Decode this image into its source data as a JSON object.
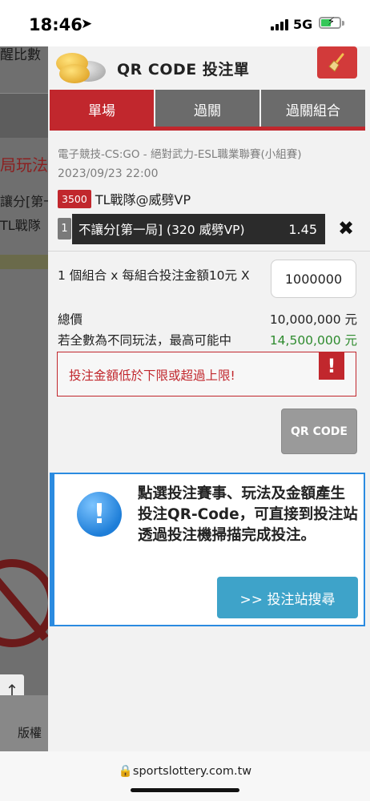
{
  "status_bar": {
    "time": "18:46",
    "network": "5G"
  },
  "background_page": {
    "texts": [
      "醒比數",
      "局玩法",
      "讓分[第一",
      "TL戰隊",
      "版權"
    ]
  },
  "modal": {
    "title": "QR CODE 投注單",
    "tabs": [
      {
        "label": "單場",
        "active": true
      },
      {
        "label": "過關",
        "active": false
      },
      {
        "label": "過關組合",
        "active": false
      }
    ],
    "bet": {
      "event_title": "電子競技-CS:GO - 絕對武力-ESL職業聯賽(小組賽)",
      "event_date": "2023/09/23 22:00",
      "match_code": "3500",
      "match_name": "TL戰隊@威劈VP",
      "pick_index": "1",
      "pick_desc": "不讓分[第一局] (320 威劈VP)",
      "odds": "1.45"
    },
    "stake": {
      "combo_text": "1 個組合 x 每組合投注金額10元 X",
      "amount": "1000000",
      "total_label": "總價",
      "total_value": "10,000,000 元",
      "max_label": "若全數為不同玩法，最高可能中",
      "max_value": "14,500,000 元",
      "error_text": "投注金額低於下限或超過上限!",
      "qr_button": "QR CODE"
    },
    "info": {
      "text": "點選投注賽事、玩法及金額產生投注QR-Code，可直接到投注站透過投注機掃描完成投注。",
      "search_button": ">> 投注站搜尋"
    }
  },
  "browser": {
    "url": "sportslottery.com.tw"
  },
  "colors": {
    "brand_red": "#c1272d",
    "tab_gray": "#6b6b6b",
    "info_blue": "#2b8be0",
    "search_teal": "#3ea3c9",
    "win_green": "#2e8b2e"
  }
}
